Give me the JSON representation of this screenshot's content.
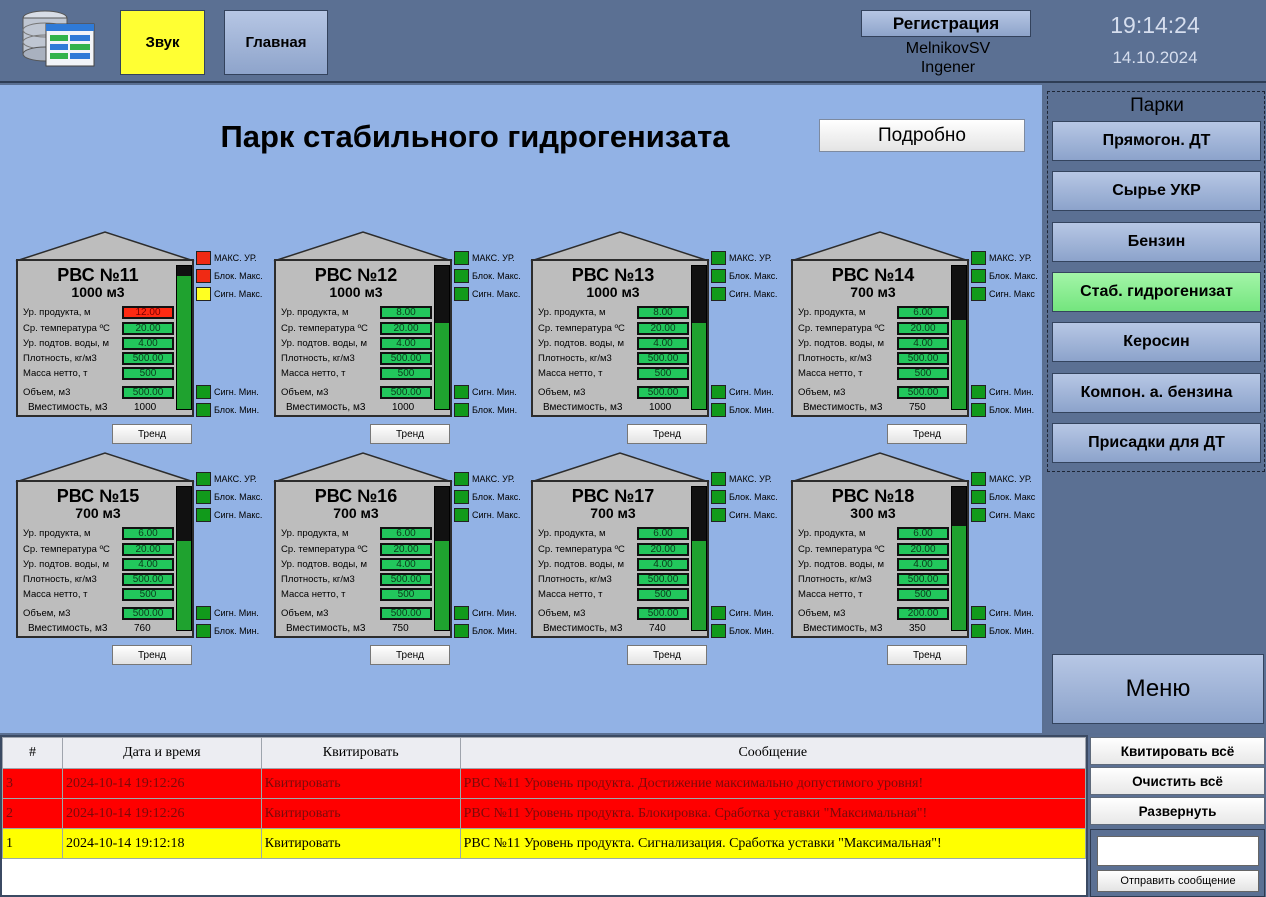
{
  "header": {
    "sound_label": "Звук",
    "main_label": "Главная",
    "registration_label": "Регистрация",
    "user_name": "MelnikovSV",
    "user_role": "Ingener",
    "time": "19:14:24",
    "date": "14.10.2024"
  },
  "main": {
    "title": "Парк стабильного гидрогенизата",
    "detail_label": "Подробно"
  },
  "tank_labels": {
    "product_level": "Ур. продукта, м",
    "avg_temp": "Ср. температура ºС",
    "water_level": "Ур. подтов. воды, м",
    "density": "Плотность, кг/м3",
    "net_mass": "Масса нетто, т",
    "volume": "Объем, м3",
    "capacity": "Вместимость, м3",
    "trend": "Тренд"
  },
  "tanks": [
    {
      "name": "РВС №11",
      "cap_label": "1000 м3",
      "level": "12.00",
      "temp": "20.00",
      "water": "4.00",
      "density": "500.00",
      "mass": "500",
      "volume": "500.00",
      "capacity": "1000",
      "fill": 0.93,
      "level_alarm": true,
      "leds": [
        {
          "label": "МАКС. УР.",
          "state": "red"
        },
        {
          "label": "Блок. Макс.",
          "state": "red"
        },
        {
          "label": "Сигн. Макс.",
          "state": "yel"
        },
        {
          "label": "Сигн. Мин.",
          "state": "green"
        },
        {
          "label": "Блок. Мин.",
          "state": "green"
        }
      ]
    },
    {
      "name": "РВС №12",
      "cap_label": "1000 м3",
      "level": "8.00",
      "temp": "20.00",
      "water": "4.00",
      "density": "500.00",
      "mass": "500",
      "volume": "500.00",
      "capacity": "1000",
      "fill": 0.6,
      "level_alarm": false,
      "leds": [
        {
          "label": "МАКС. УР.",
          "state": "green"
        },
        {
          "label": "Блок. Макс.",
          "state": "green"
        },
        {
          "label": "Сигн. Макс.",
          "state": "green"
        },
        {
          "label": "Сигн. Мин.",
          "state": "green"
        },
        {
          "label": "Блок. Мин.",
          "state": "green"
        }
      ]
    },
    {
      "name": "РВС №13",
      "cap_label": "1000 м3",
      "level": "8.00",
      "temp": "20.00",
      "water": "4.00",
      "density": "500.00",
      "mass": "500",
      "volume": "500.00",
      "capacity": "1000",
      "fill": 0.6,
      "level_alarm": false,
      "leds": [
        {
          "label": "МАКС. УР.",
          "state": "green"
        },
        {
          "label": "Блок. Макс.",
          "state": "green"
        },
        {
          "label": "Сигн. Макс.",
          "state": "green"
        },
        {
          "label": "Сигн. Мин.",
          "state": "green"
        },
        {
          "label": "Блок. Мин.",
          "state": "green"
        }
      ]
    },
    {
      "name": "РВС №14",
      "cap_label": "700 м3",
      "level": "6.00",
      "temp": "20.00",
      "water": "4.00",
      "density": "500.00",
      "mass": "500",
      "volume": "500.00",
      "capacity": "750",
      "fill": 0.62,
      "level_alarm": false,
      "leds": [
        {
          "label": "МАКС. УР.",
          "state": "green"
        },
        {
          "label": "Блок. Макс.",
          "state": "green"
        },
        {
          "label": "Сигн. Макс",
          "state": "green"
        },
        {
          "label": "Сигн. Мин.",
          "state": "green"
        },
        {
          "label": "Блок. Мин.",
          "state": "green"
        }
      ]
    },
    {
      "name": "РВС №15",
      "cap_label": "700 м3",
      "level": "6.00",
      "temp": "20.00",
      "water": "4.00",
      "density": "500.00",
      "mass": "500",
      "volume": "500.00",
      "capacity": "760",
      "fill": 0.62,
      "level_alarm": false,
      "leds": [
        {
          "label": "МАКС. УР.",
          "state": "green"
        },
        {
          "label": "Блок. Макс.",
          "state": "green"
        },
        {
          "label": "Сигн. Макс.",
          "state": "green"
        },
        {
          "label": "Сигн. Мин.",
          "state": "green"
        },
        {
          "label": "Блок. Мин.",
          "state": "green"
        }
      ]
    },
    {
      "name": "РВС №16",
      "cap_label": "700 м3",
      "level": "6.00",
      "temp": "20.00",
      "water": "4.00",
      "density": "500.00",
      "mass": "500",
      "volume": "500.00",
      "capacity": "750",
      "fill": 0.62,
      "level_alarm": false,
      "leds": [
        {
          "label": "МАКС. УР.",
          "state": "green"
        },
        {
          "label": "Блок. Макс.",
          "state": "green"
        },
        {
          "label": "Сигн. Макс.",
          "state": "green"
        },
        {
          "label": "Сигн. Мин.",
          "state": "green"
        },
        {
          "label": "Блок. Мин.",
          "state": "green"
        }
      ]
    },
    {
      "name": "РВС №17",
      "cap_label": "700 м3",
      "level": "6.00",
      "temp": "20.00",
      "water": "4.00",
      "density": "500.00",
      "mass": "500",
      "volume": "500.00",
      "capacity": "740",
      "fill": 0.62,
      "level_alarm": false,
      "leds": [
        {
          "label": "МАКС. УР.",
          "state": "green"
        },
        {
          "label": "Блок. Макс.",
          "state": "green"
        },
        {
          "label": "Сигн. Макс.",
          "state": "green"
        },
        {
          "label": "Сигн. Мин.",
          "state": "green"
        },
        {
          "label": "Блок. Мин.",
          "state": "green"
        }
      ]
    },
    {
      "name": "РВС №18",
      "cap_label": "300 м3",
      "level": "6.00",
      "temp": "20.00",
      "water": "4.00",
      "density": "500.00",
      "mass": "500",
      "volume": "200.00",
      "capacity": "350",
      "fill": 0.73,
      "level_alarm": false,
      "leds": [
        {
          "label": "МАКС. УР.",
          "state": "green"
        },
        {
          "label": "Блок. Макс",
          "state": "green"
        },
        {
          "label": "Сигн. Макс",
          "state": "green"
        },
        {
          "label": "Сигн. Мин.",
          "state": "green"
        },
        {
          "label": "Блок. Мин.",
          "state": "green"
        }
      ]
    }
  ],
  "sidebar": {
    "title": "Парки",
    "parks": [
      {
        "label": "Прямогон. ДТ",
        "active": false
      },
      {
        "label": "Сырье УКР",
        "active": false
      },
      {
        "label": "Бензин",
        "active": false
      },
      {
        "label": "Стаб. гидрогенизат",
        "active": true
      },
      {
        "label": "Керосин",
        "active": false
      },
      {
        "label": "Компон. а. бензина",
        "active": false
      },
      {
        "label": "Присадки для ДТ",
        "active": false
      }
    ],
    "menu_label": "Меню"
  },
  "alarms": {
    "columns": [
      "#",
      "Дата и время",
      "Квитировать",
      "Сообщение"
    ],
    "rows": [
      {
        "num": "3",
        "datetime": "2024-10-14 19:12:26",
        "ack": "Квитировать",
        "message": "РВС №11 Уровень продукта. Достижение максимально допустимого уровня!",
        "level": "red"
      },
      {
        "num": "2",
        "datetime": "2024-10-14 19:12:26",
        "ack": "Квитировать",
        "message": "РВС №11 Уровень продукта. Блокировка. Сработка уставки \"Максимальная\"!",
        "level": "red"
      },
      {
        "num": "1",
        "datetime": "2024-10-14 19:12:18",
        "ack": "Квитировать",
        "message": "РВС №11 Уровень продукта. Сигнализация. Сработка уставки \"Максимальная\"!",
        "level": "yel"
      }
    ],
    "ack_all_label": "Квитировать всё",
    "clear_all_label": "Очистить всё",
    "expand_label": "Развернуть",
    "message_placeholder": "",
    "send_label": "Отправить сообщение"
  }
}
